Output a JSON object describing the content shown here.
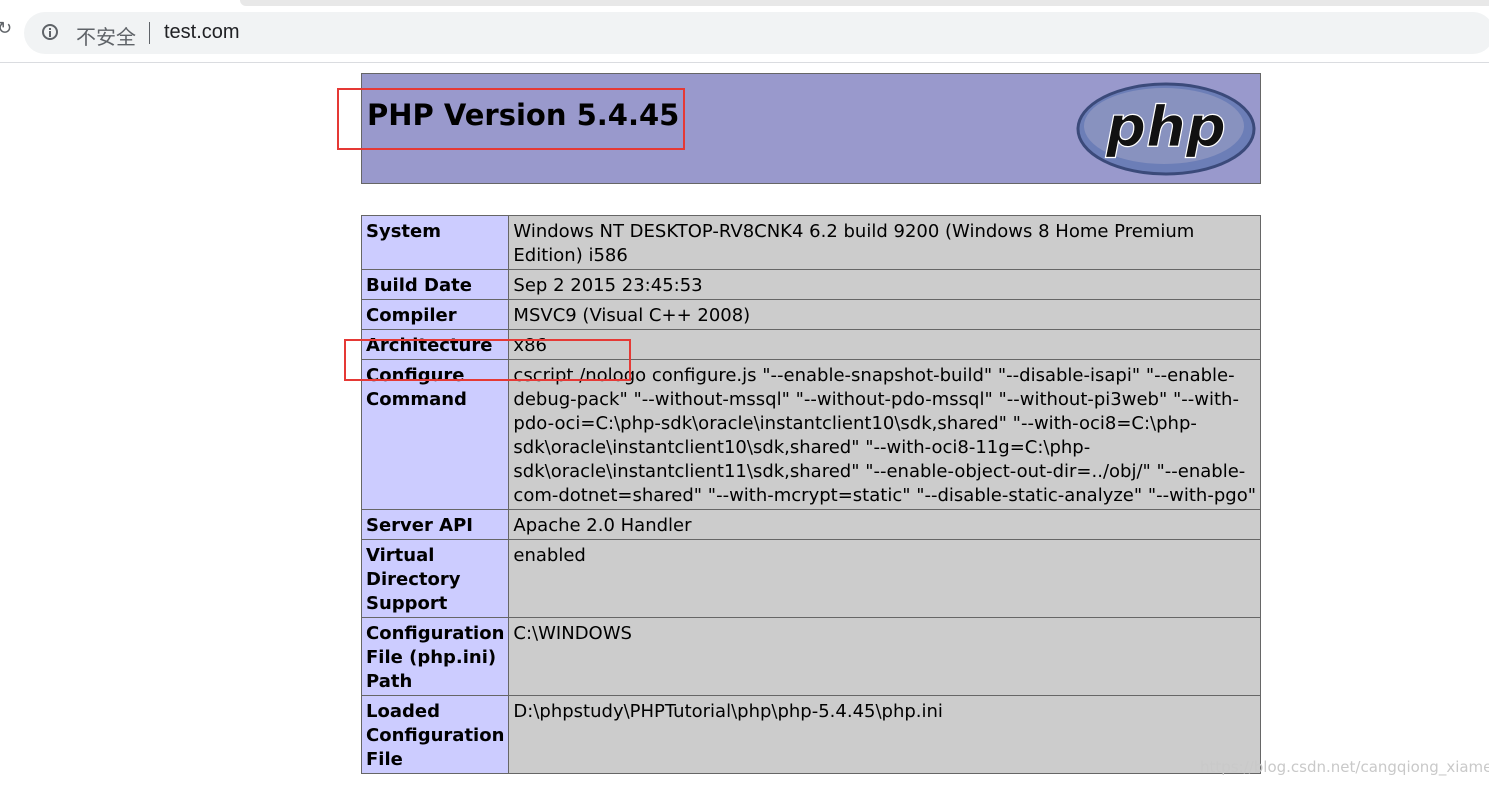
{
  "browser": {
    "security_label": "不安全",
    "url": "test.com"
  },
  "header": {
    "title": "PHP Version 5.4.45",
    "logo_text": "php"
  },
  "rows": [
    {
      "key": "System",
      "value": "Windows NT DESKTOP-RV8CNK4 6.2 build 9200 (Windows 8 Home Premium Edition) i586"
    },
    {
      "key": "Build Date",
      "value": "Sep 2 2015 23:45:53"
    },
    {
      "key": "Compiler",
      "value": "MSVC9 (Visual C++ 2008)"
    },
    {
      "key": "Architecture",
      "value": "x86"
    },
    {
      "key": "Configure Command",
      "value": "cscript /nologo configure.js \"--enable-snapshot-build\" \"--disable-isapi\" \"--enable-debug-pack\" \"--without-mssql\" \"--without-pdo-mssql\" \"--without-pi3web\" \"--with-pdo-oci=C:\\php-sdk\\oracle\\instantclient10\\sdk,shared\" \"--with-oci8=C:\\php-sdk\\oracle\\instantclient10\\sdk,shared\" \"--with-oci8-11g=C:\\php-sdk\\oracle\\instantclient11\\sdk,shared\" \"--enable-object-out-dir=../obj/\" \"--enable-com-dotnet=shared\" \"--with-mcrypt=static\" \"--disable-static-analyze\" \"--with-pgo\""
    },
    {
      "key": "Server API",
      "value": "Apache 2.0 Handler"
    },
    {
      "key": "Virtual Directory Support",
      "value": "enabled"
    },
    {
      "key": "Configuration File (php.ini) Path",
      "value": "C:\\WINDOWS"
    },
    {
      "key": "Loaded Configuration File",
      "value": "D:\\phpstudy\\PHPTutorial\\php\\php-5.4.45\\php.ini"
    }
  ],
  "watermark": "https://blog.csdn.net/cangqiong_xiamen",
  "colors": {
    "header_bg": "#9999cc",
    "key_bg": "#ccccff",
    "value_bg": "#cccccc",
    "highlight": "#e53935"
  }
}
